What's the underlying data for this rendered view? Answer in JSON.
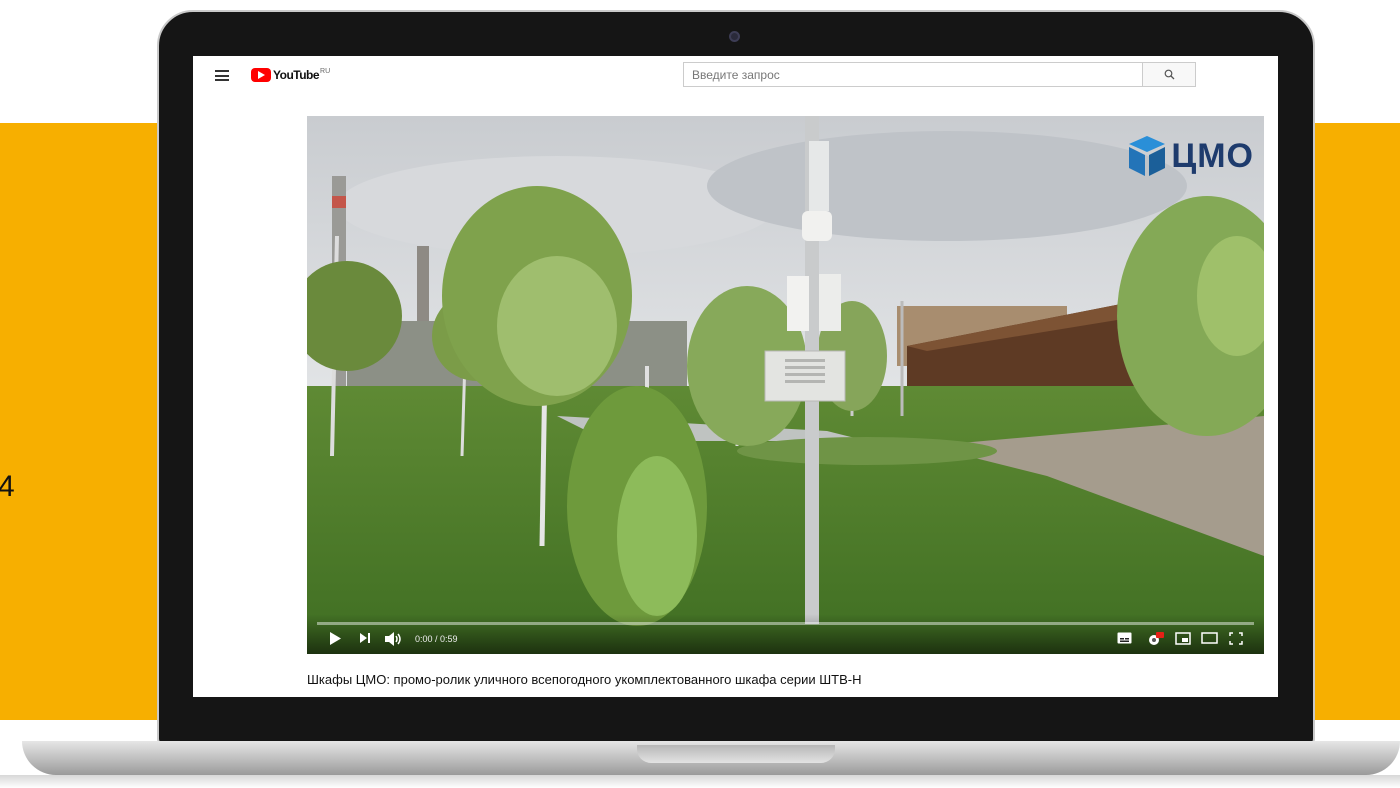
{
  "background": {
    "band_color": "#f7af00",
    "partial_number": "4"
  },
  "youtube": {
    "logo_text": "YouTube",
    "logo_region": "RU",
    "search_placeholder": "Введите запрос"
  },
  "video": {
    "watermark_text": "ЦМО",
    "time": "0:00 / 0:59",
    "title": "Шкафы ЦМО: промо-ролик уличного всепогодного укомплектованного шкафа серии ШТВ-Н"
  },
  "icons": {
    "menu": "menu-icon",
    "search": "search-icon",
    "play": "play-icon",
    "next": "next-icon",
    "volume": "volume-icon",
    "subtitles": "subtitles-icon",
    "settings": "settings-hd-icon",
    "miniplayer": "miniplayer-icon",
    "theater": "theater-mode-icon",
    "fullscreen": "fullscreen-icon"
  }
}
